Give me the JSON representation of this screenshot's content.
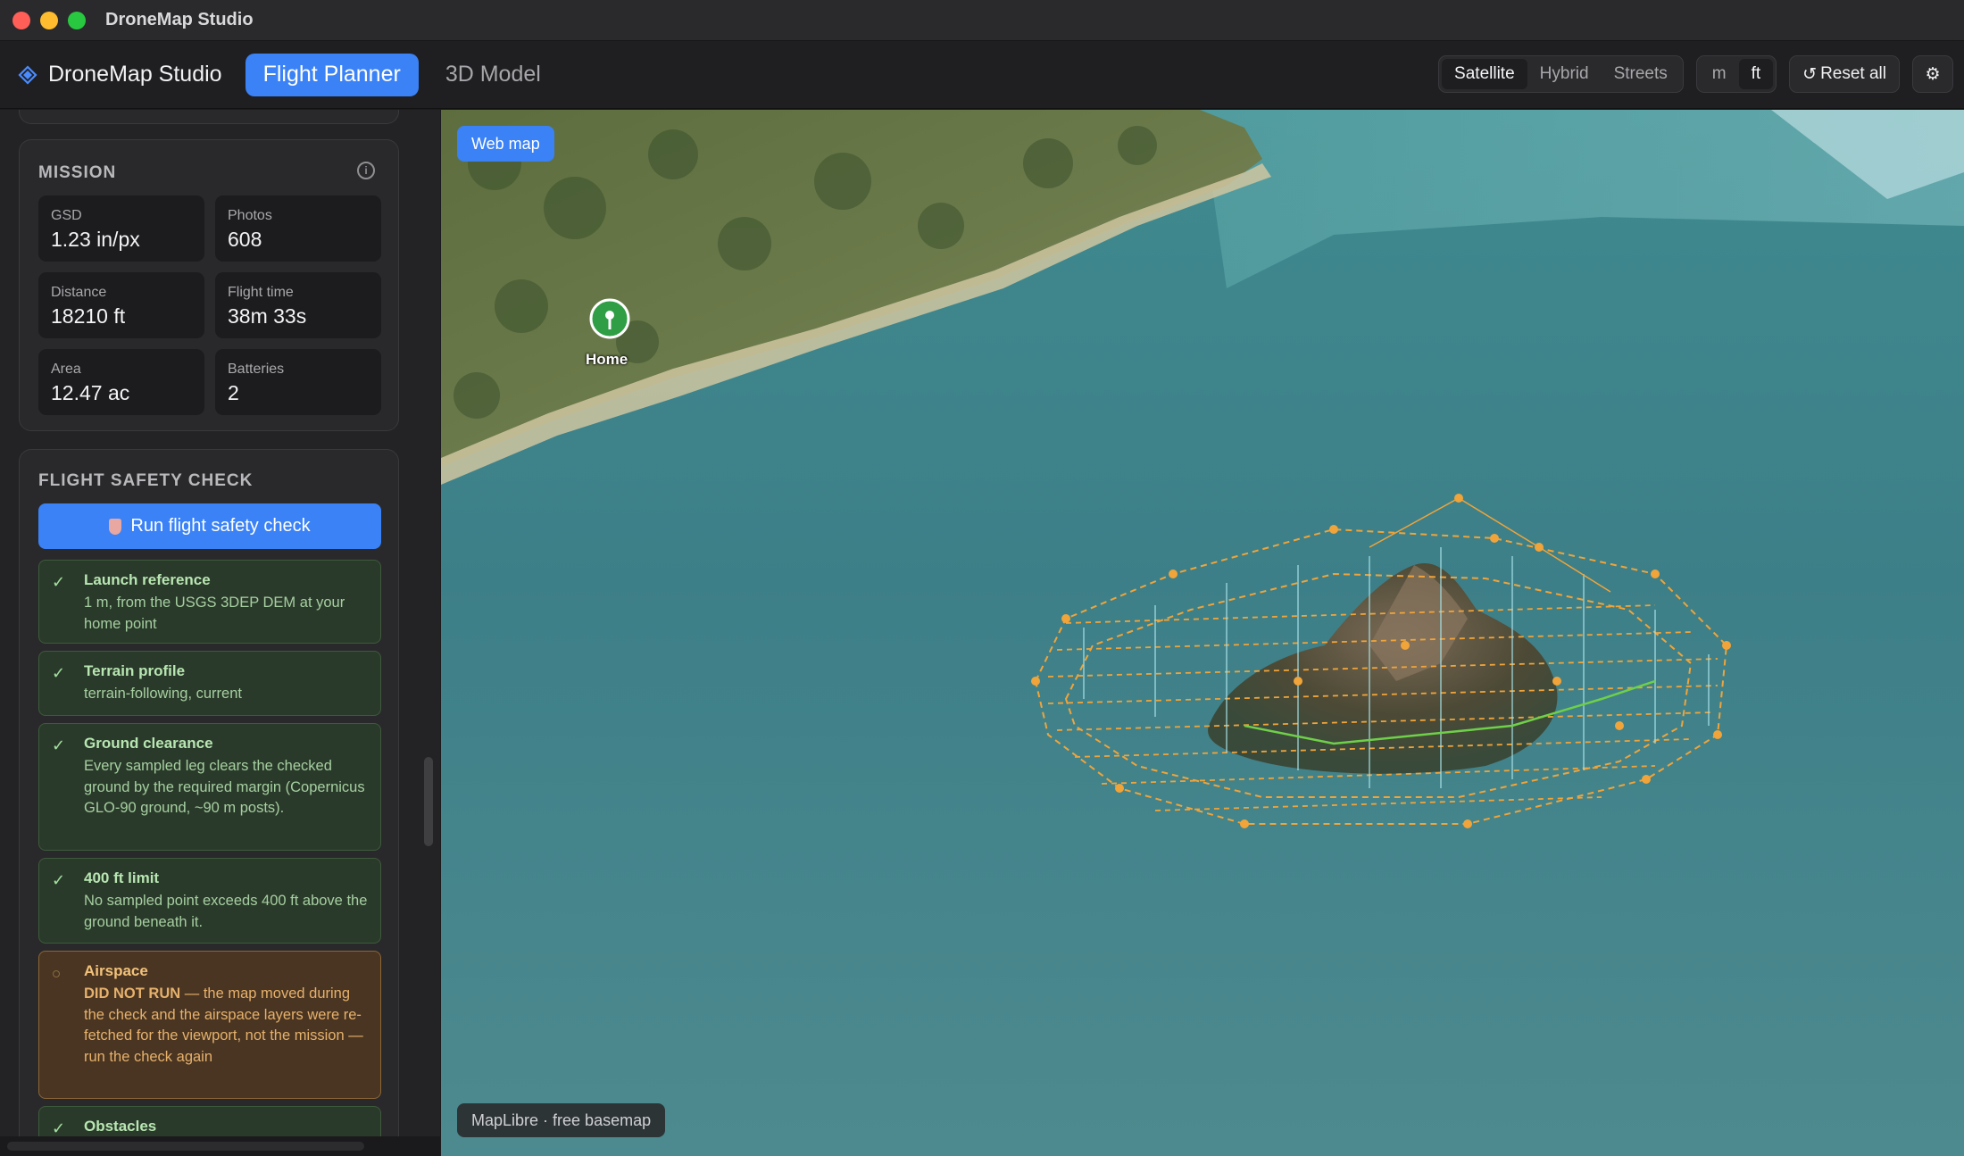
{
  "window": {
    "title": "DroneMap Studio"
  },
  "header": {
    "brand": "DroneMap Studio",
    "tabs": [
      {
        "label": "Flight Planner",
        "active": true
      },
      {
        "label": "3D Model",
        "active": false
      }
    ],
    "basemaps": [
      {
        "label": "Satellite",
        "active": true
      },
      {
        "label": "Hybrid",
        "active": false
      },
      {
        "label": "Streets",
        "active": false
      }
    ],
    "units": [
      {
        "label": "m",
        "active": false
      },
      {
        "label": "ft",
        "active": true
      }
    ],
    "reset_label": "Reset all",
    "reset_icon": "↺",
    "settings_icon": "⚙"
  },
  "mission": {
    "title": "MISSION",
    "info_icon": "i",
    "stats": [
      {
        "label": "GSD",
        "value": "1.23 in/px"
      },
      {
        "label": "Photos",
        "value": "608"
      },
      {
        "label": "Distance",
        "value": "18210 ft"
      },
      {
        "label": "Flight time",
        "value": "38m 33s"
      },
      {
        "label": "Area",
        "value": "12.47 ac"
      },
      {
        "label": "Batteries",
        "value": "2"
      }
    ]
  },
  "safety": {
    "title": "FLIGHT SAFETY CHECK",
    "run_label": "Run flight safety check",
    "tick": "✓",
    "items": [
      {
        "title": "Launch reference",
        "body": "1 m, from the USGS 3DEP DEM at your home point",
        "status": "ok"
      },
      {
        "title": "Terrain profile",
        "body": "terrain-following, current",
        "status": "ok"
      },
      {
        "title": "Ground clearance",
        "body": "Every sampled leg clears the checked ground by the required margin (Copernicus GLO-90 ground, ~90 m posts).",
        "status": "ok"
      },
      {
        "title": "400 ft limit",
        "body": "No sampled point exceeds 400 ft above the ground beneath it.",
        "status": "ok"
      },
      {
        "title": "Airspace",
        "body_bold": "DID NOT RUN",
        "body": " — the map moved during the check and the airspace layers were re-fetched for the viewport, not the mission — run the check again",
        "status": "warn"
      },
      {
        "title": "Obstacles",
        "body": "",
        "status": "ok"
      }
    ]
  },
  "map": {
    "webmap_label": "Web map",
    "home_label": "Home",
    "attribution": "MapLibre · free basemap"
  }
}
